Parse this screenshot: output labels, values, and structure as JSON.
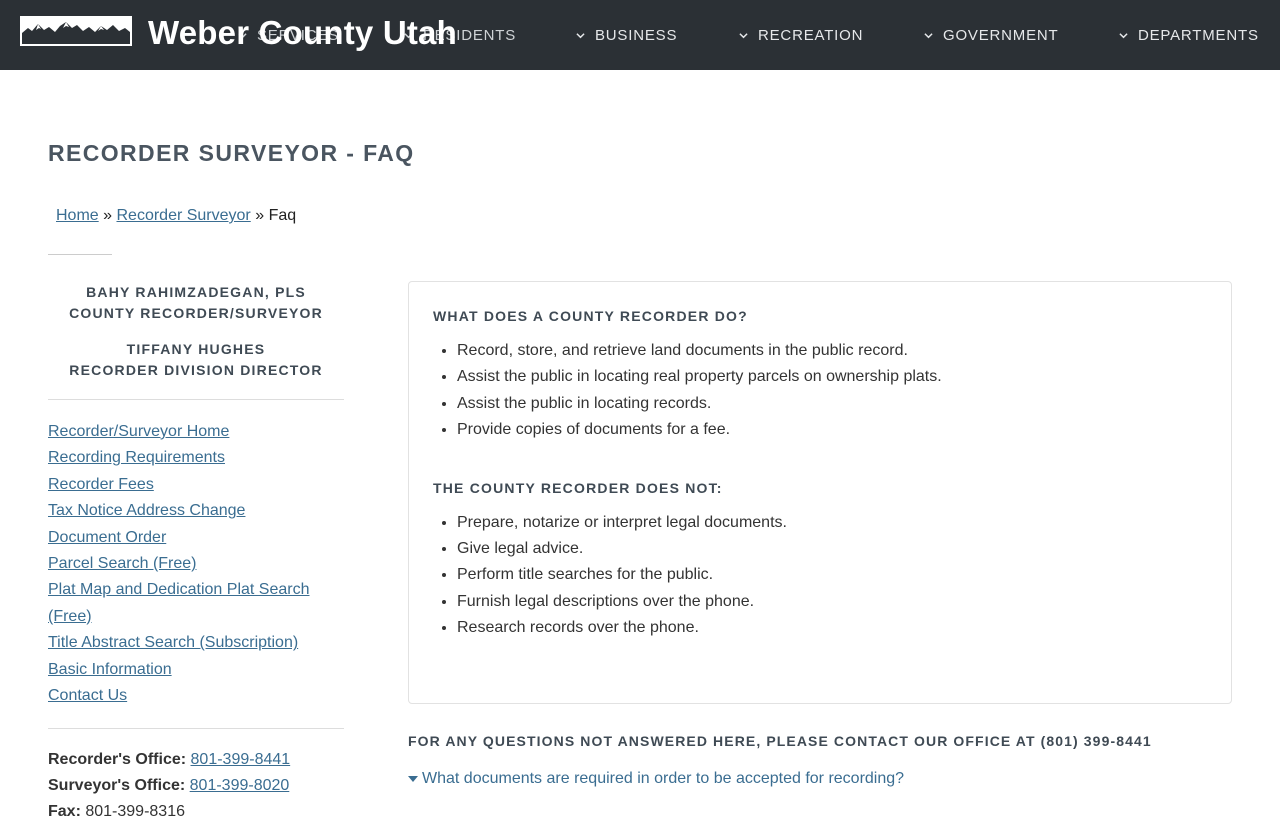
{
  "header": {
    "site_title": "Weber County Utah",
    "logo_alt": "mountain-logo",
    "nav": [
      {
        "label": "SERVICES"
      },
      {
        "label": "RESIDENTS"
      },
      {
        "label": "BUSINESS"
      },
      {
        "label": "RECREATION"
      },
      {
        "label": "GOVERNMENT"
      },
      {
        "label": "DEPARTMENTS"
      }
    ],
    "colors": {
      "bar": "#2b3035",
      "text": "#ffffff"
    }
  },
  "page": {
    "title": "RECORDER SURVEYOR - FAQ",
    "breadcrumb": {
      "home": "Home",
      "sep1": " » ",
      "section": "Recorder Surveyor",
      "sep2": " » ",
      "current": "Faq"
    }
  },
  "sidebar": {
    "staff": [
      {
        "name": "BAHY RAHIMZADEGAN, PLS",
        "role": "COUNTY RECORDER/SURVEYOR"
      },
      {
        "name": "TIFFANY HUGHES",
        "role": "RECORDER DIVISION DIRECTOR"
      }
    ],
    "links": [
      "Recorder/Surveyor Home",
      "Recording Requirements",
      "Recorder Fees",
      "Tax Notice Address Change",
      "Document Order",
      "Parcel Search (Free)",
      "Plat Map and Dedication Plat Search (Free)",
      "Title Abstract Search (Subscription)",
      "Basic Information",
      "Contact Us"
    ],
    "contacts": [
      {
        "label": "Recorder's Office:",
        "phone": "801-399-8441"
      },
      {
        "label": "Surveyor's Office:",
        "phone": "801-399-8020"
      },
      {
        "label": "Fax:",
        "phone": "801-399-8316"
      }
    ]
  },
  "faq_card": {
    "heading1": "WHAT DOES A COUNTY RECORDER DO?",
    "does": [
      "Record, store, and retrieve land documents in the public record.",
      "Assist the public in locating real property parcels on ownership plats.",
      "Assist the public in locating records.",
      "Provide copies of documents for a fee."
    ],
    "heading2": "THE COUNTY RECORDER DOES NOT:",
    "does_not": [
      "Prepare, notarize or interpret legal documents.",
      "Give legal advice.",
      "Perform title searches for the public.",
      "Furnish legal descriptions over the phone.",
      "Research records over the phone."
    ]
  },
  "questions": {
    "note": "FOR ANY QUESTIONS NOT ANSWERED HERE, PLEASE CONTACT OUR OFFICE AT (801) 399-8441",
    "first_question": "What documents are required in order to be accepted for recording?"
  },
  "accent_color": "#3a6d91"
}
